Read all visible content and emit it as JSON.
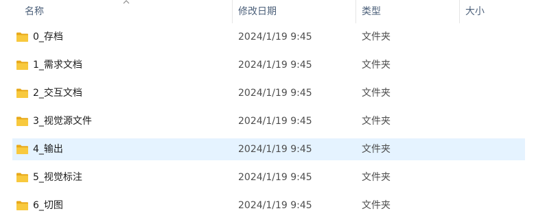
{
  "header": {
    "name": "名称",
    "date_modified": "修改日期",
    "type": "类型",
    "size": "大小",
    "sort_icon": "chevron-up-icon"
  },
  "rows": [
    {
      "name": "0_存档",
      "date": "2024/1/19 9:45",
      "type": "文件夹",
      "icon": "folder-icon",
      "selected": false
    },
    {
      "name": "1_需求文档",
      "date": "2024/1/19 9:45",
      "type": "文件夹",
      "icon": "folder-icon",
      "selected": false
    },
    {
      "name": "2_交互文档",
      "date": "2024/1/19 9:45",
      "type": "文件夹",
      "icon": "folder-icon",
      "selected": false
    },
    {
      "name": "3_视觉源文件",
      "date": "2024/1/19 9:45",
      "type": "文件夹",
      "icon": "folder-icon",
      "selected": false
    },
    {
      "name": "4_输出",
      "date": "2024/1/19 9:45",
      "type": "文件夹",
      "icon": "folder-icon",
      "selected": true
    },
    {
      "name": "5_视觉标注",
      "date": "2024/1/19 9:45",
      "type": "文件夹",
      "icon": "folder-icon",
      "selected": false
    },
    {
      "name": "6_切图",
      "date": "2024/1/19 9:45",
      "type": "文件夹",
      "icon": "folder-icon",
      "selected": false
    }
  ],
  "colors": {
    "folder": "#f8c93e",
    "folder_back": "#e8a91a",
    "selected_row": "#e5f3ff",
    "header_text": "#4c607a"
  }
}
